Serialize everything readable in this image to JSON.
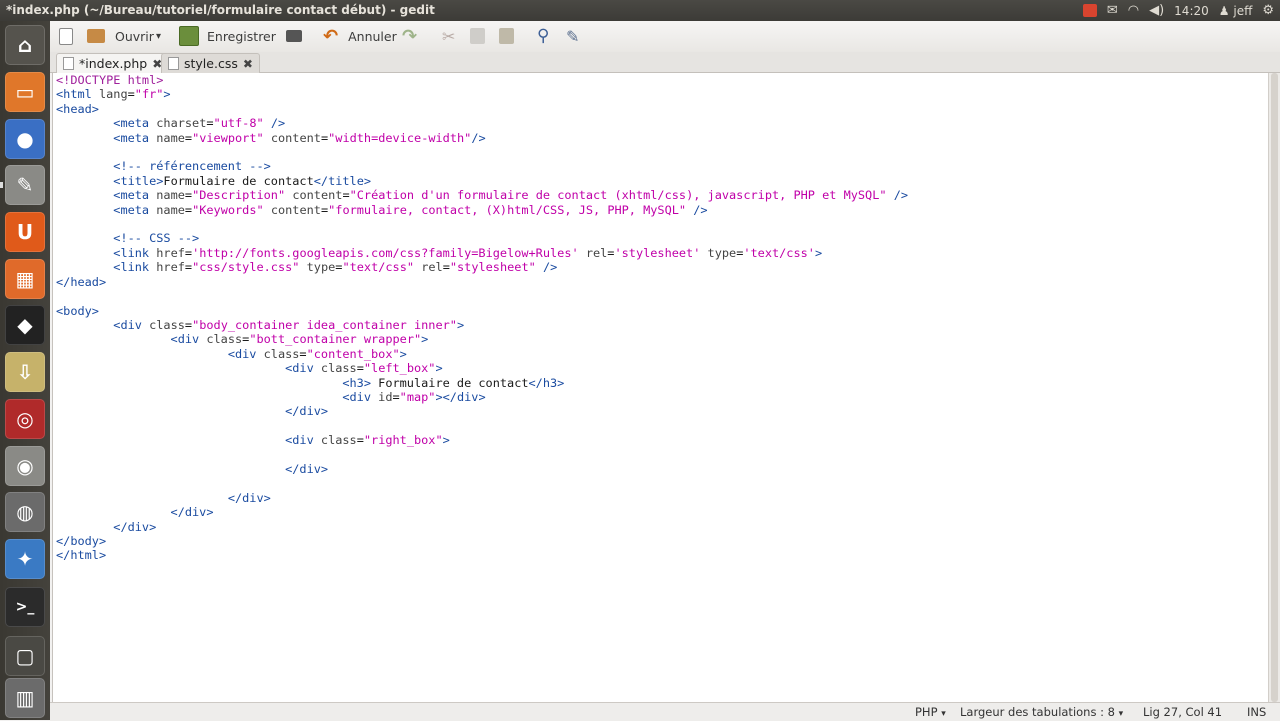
{
  "window": {
    "title": "*index.php (~/Bureau/tutoriel/formulaire contact début) - gedit"
  },
  "tray": {
    "time": "14:20",
    "user": "jeff"
  },
  "launcher": {
    "items": [
      {
        "name": "dash-home",
        "glyph": "⌂",
        "color": "#55534d"
      },
      {
        "name": "files",
        "glyph": "▭",
        "color": "#e0772a"
      },
      {
        "name": "firefox",
        "glyph": "●",
        "color": "#3a6fc4"
      },
      {
        "name": "gedit",
        "glyph": "✎",
        "color": "#8a8a86"
      },
      {
        "name": "ubuntu-one",
        "glyph": "U",
        "color": "#e05a1a"
      },
      {
        "name": "app-orange",
        "glyph": "▦",
        "color": "#e06a2a"
      },
      {
        "name": "app-black-yellow",
        "glyph": "◆",
        "color": "#222222"
      },
      {
        "name": "install-downloads",
        "glyph": "⇩",
        "color": "#c6b26a"
      },
      {
        "name": "app-red-swirl",
        "glyph": "◎",
        "color": "#b02a2a"
      },
      {
        "name": "webcam",
        "glyph": "◉",
        "color": "#8a8a86"
      },
      {
        "name": "app-eyes",
        "glyph": "◍",
        "color": "#6b6b6b"
      },
      {
        "name": "app-feather",
        "glyph": "✦",
        "color": "#3a7ac4"
      },
      {
        "name": "terminal",
        "glyph": ">_",
        "color": "#2b2b2b"
      },
      {
        "name": "workspace-switcher",
        "glyph": "▢",
        "color": "#4a4944"
      },
      {
        "name": "trash",
        "glyph": "▥",
        "color": "#6b6b6b"
      }
    ]
  },
  "toolbar": {
    "open_label": "Ouvrir",
    "dropdown_glyph": "▾",
    "save_label": "Enregistrer",
    "undo_label": "Annuler"
  },
  "tabs": [
    {
      "label": "*index.php",
      "close": "✖"
    },
    {
      "label": "style.css",
      "close": "✖"
    }
  ],
  "editor": {
    "lines": [
      "<!DOCTYPE html>",
      "<html lang=\"fr\">",
      "<head>",
      "        <meta charset=\"utf-8\" />",
      "        <meta name=\"viewport\" content=\"width=device-width\"/>",
      "",
      "        <!-- référencement -->",
      "        <title>Formulaire de contact</title>",
      "        <meta name=\"Description\" content=\"Création d'un formulaire de contact (xhtml/css), javascript, PHP et MySQL\" />",
      "        <meta name=\"Keywords\" content=\"formulaire, contact, (X)html/CSS, JS, PHP, MySQL\" />",
      "",
      "        <!-- CSS -->",
      "        <link href='http://fonts.googleapis.com/css?family=Bigelow+Rules' rel='stylesheet' type='text/css'>",
      "        <link href=\"css/style.css\" type=\"text/css\" rel=\"stylesheet\" />",
      "</head>",
      "",
      "<body>",
      "        <div class=\"body_container idea_container inner\">",
      "                <div class=\"bott_container wrapper\">",
      "                        <div class=\"content_box\">",
      "                                <div class=\"left_box\">",
      "                                        <h3> Formulaire de contact</h3>",
      "                                        <div id=\"map\"></div>",
      "                                </div>",
      "",
      "                                <div class=\"right_box\">",
      "",
      "                                </div>",
      "",
      "                        </div>",
      "                </div>",
      "        </div>",
      "</body>",
      "</html>"
    ]
  },
  "status": {
    "language": "PHP",
    "tab_width": "Largeur des tabulations : 8",
    "position": "Lig 27, Col 41",
    "mode": "INS",
    "dropdown_glyph": "▾"
  }
}
